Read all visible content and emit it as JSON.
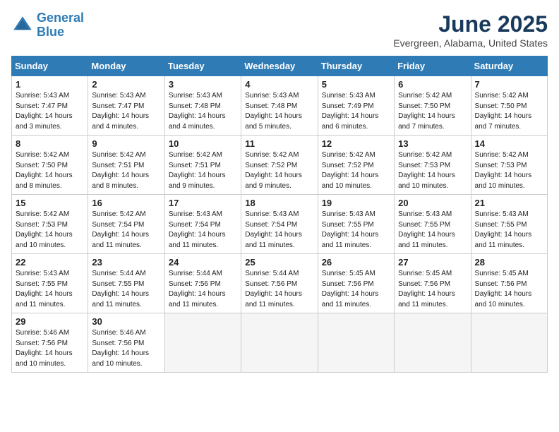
{
  "header": {
    "logo_line1": "General",
    "logo_line2": "Blue",
    "month": "June 2025",
    "location": "Evergreen, Alabama, United States"
  },
  "days_of_week": [
    "Sunday",
    "Monday",
    "Tuesday",
    "Wednesday",
    "Thursday",
    "Friday",
    "Saturday"
  ],
  "weeks": [
    [
      {
        "num": "1",
        "sunrise": "5:43 AM",
        "sunset": "7:47 PM",
        "daylight": "14 hours and 3 minutes."
      },
      {
        "num": "2",
        "sunrise": "5:43 AM",
        "sunset": "7:47 PM",
        "daylight": "14 hours and 4 minutes."
      },
      {
        "num": "3",
        "sunrise": "5:43 AM",
        "sunset": "7:48 PM",
        "daylight": "14 hours and 4 minutes."
      },
      {
        "num": "4",
        "sunrise": "5:43 AM",
        "sunset": "7:48 PM",
        "daylight": "14 hours and 5 minutes."
      },
      {
        "num": "5",
        "sunrise": "5:43 AM",
        "sunset": "7:49 PM",
        "daylight": "14 hours and 6 minutes."
      },
      {
        "num": "6",
        "sunrise": "5:42 AM",
        "sunset": "7:50 PM",
        "daylight": "14 hours and 7 minutes."
      },
      {
        "num": "7",
        "sunrise": "5:42 AM",
        "sunset": "7:50 PM",
        "daylight": "14 hours and 7 minutes."
      }
    ],
    [
      {
        "num": "8",
        "sunrise": "5:42 AM",
        "sunset": "7:50 PM",
        "daylight": "14 hours and 8 minutes."
      },
      {
        "num": "9",
        "sunrise": "5:42 AM",
        "sunset": "7:51 PM",
        "daylight": "14 hours and 8 minutes."
      },
      {
        "num": "10",
        "sunrise": "5:42 AM",
        "sunset": "7:51 PM",
        "daylight": "14 hours and 9 minutes."
      },
      {
        "num": "11",
        "sunrise": "5:42 AM",
        "sunset": "7:52 PM",
        "daylight": "14 hours and 9 minutes."
      },
      {
        "num": "12",
        "sunrise": "5:42 AM",
        "sunset": "7:52 PM",
        "daylight": "14 hours and 10 minutes."
      },
      {
        "num": "13",
        "sunrise": "5:42 AM",
        "sunset": "7:53 PM",
        "daylight": "14 hours and 10 minutes."
      },
      {
        "num": "14",
        "sunrise": "5:42 AM",
        "sunset": "7:53 PM",
        "daylight": "14 hours and 10 minutes."
      }
    ],
    [
      {
        "num": "15",
        "sunrise": "5:42 AM",
        "sunset": "7:53 PM",
        "daylight": "14 hours and 10 minutes."
      },
      {
        "num": "16",
        "sunrise": "5:42 AM",
        "sunset": "7:54 PM",
        "daylight": "14 hours and 11 minutes."
      },
      {
        "num": "17",
        "sunrise": "5:43 AM",
        "sunset": "7:54 PM",
        "daylight": "14 hours and 11 minutes."
      },
      {
        "num": "18",
        "sunrise": "5:43 AM",
        "sunset": "7:54 PM",
        "daylight": "14 hours and 11 minutes."
      },
      {
        "num": "19",
        "sunrise": "5:43 AM",
        "sunset": "7:55 PM",
        "daylight": "14 hours and 11 minutes."
      },
      {
        "num": "20",
        "sunrise": "5:43 AM",
        "sunset": "7:55 PM",
        "daylight": "14 hours and 11 minutes."
      },
      {
        "num": "21",
        "sunrise": "5:43 AM",
        "sunset": "7:55 PM",
        "daylight": "14 hours and 11 minutes."
      }
    ],
    [
      {
        "num": "22",
        "sunrise": "5:43 AM",
        "sunset": "7:55 PM",
        "daylight": "14 hours and 11 minutes."
      },
      {
        "num": "23",
        "sunrise": "5:44 AM",
        "sunset": "7:55 PM",
        "daylight": "14 hours and 11 minutes."
      },
      {
        "num": "24",
        "sunrise": "5:44 AM",
        "sunset": "7:56 PM",
        "daylight": "14 hours and 11 minutes."
      },
      {
        "num": "25",
        "sunrise": "5:44 AM",
        "sunset": "7:56 PM",
        "daylight": "14 hours and 11 minutes."
      },
      {
        "num": "26",
        "sunrise": "5:45 AM",
        "sunset": "7:56 PM",
        "daylight": "14 hours and 11 minutes."
      },
      {
        "num": "27",
        "sunrise": "5:45 AM",
        "sunset": "7:56 PM",
        "daylight": "14 hours and 11 minutes."
      },
      {
        "num": "28",
        "sunrise": "5:45 AM",
        "sunset": "7:56 PM",
        "daylight": "14 hours and 10 minutes."
      }
    ],
    [
      {
        "num": "29",
        "sunrise": "5:46 AM",
        "sunset": "7:56 PM",
        "daylight": "14 hours and 10 minutes."
      },
      {
        "num": "30",
        "sunrise": "5:46 AM",
        "sunset": "7:56 PM",
        "daylight": "14 hours and 10 minutes."
      },
      {
        "num": "",
        "sunrise": "",
        "sunset": "",
        "daylight": ""
      },
      {
        "num": "",
        "sunrise": "",
        "sunset": "",
        "daylight": ""
      },
      {
        "num": "",
        "sunrise": "",
        "sunset": "",
        "daylight": ""
      },
      {
        "num": "",
        "sunrise": "",
        "sunset": "",
        "daylight": ""
      },
      {
        "num": "",
        "sunrise": "",
        "sunset": "",
        "daylight": ""
      }
    ]
  ]
}
